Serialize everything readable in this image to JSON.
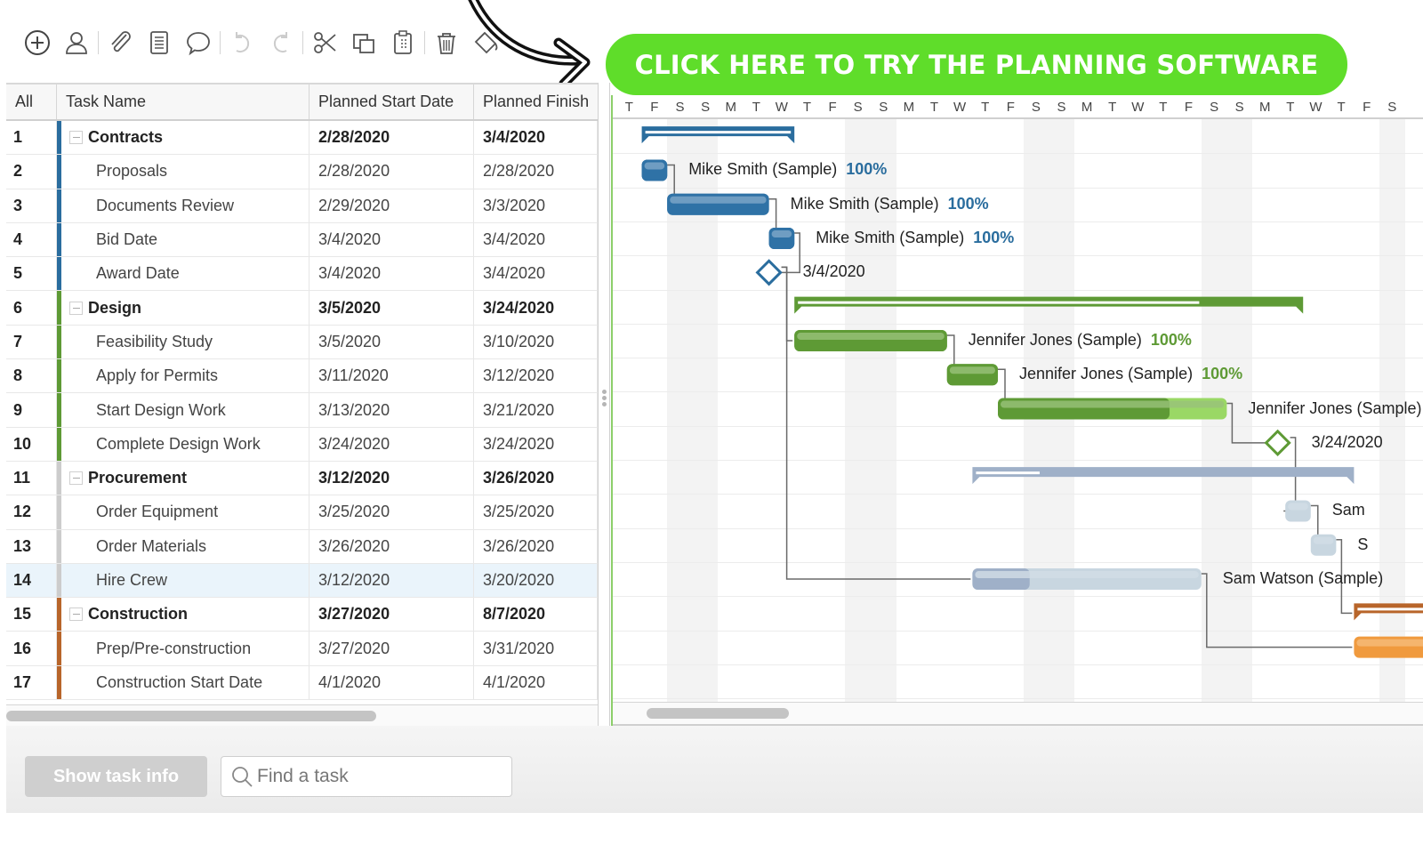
{
  "toolbar": {
    "groups": [
      [
        {
          "icon": "add-circle-icon",
          "label": "Add task"
        },
        {
          "icon": "user-icon",
          "label": "Assign user"
        }
      ],
      [
        {
          "icon": "paperclip-icon",
          "label": "Attach"
        },
        {
          "icon": "document-icon",
          "label": "Notes"
        },
        {
          "icon": "comment-icon",
          "label": "Comment"
        }
      ],
      [
        {
          "icon": "undo-icon",
          "label": "Undo"
        },
        {
          "icon": "redo-icon",
          "label": "Redo"
        }
      ],
      [
        {
          "icon": "scissors-icon",
          "label": "Cut"
        },
        {
          "icon": "copy-icon",
          "label": "Copy"
        },
        {
          "icon": "clipboard-icon",
          "label": "Paste"
        }
      ],
      [
        {
          "icon": "trash-icon",
          "label": "Delete"
        },
        {
          "icon": "paint-bucket-icon",
          "label": "Fill color"
        }
      ]
    ]
  },
  "cta": {
    "label": "CLICK HERE TO TRY THE PLANNING SOFTWARE",
    "color": "#5fdd2a"
  },
  "grid": {
    "columns": {
      "num": "All",
      "name": "Task Name",
      "start": "Planned Start Date",
      "finish": "Planned Finish"
    },
    "rows": [
      {
        "num": "1",
        "name": "Contracts",
        "start": "2/28/2020",
        "finish": "3/4/2020",
        "group": true,
        "color": "#2a6d9e"
      },
      {
        "num": "2",
        "name": "Proposals",
        "start": "2/28/2020",
        "finish": "2/28/2020",
        "group": false,
        "color": "#2a6d9e"
      },
      {
        "num": "3",
        "name": "Documents Review",
        "start": "2/29/2020",
        "finish": "3/3/2020",
        "group": false,
        "color": "#2a6d9e"
      },
      {
        "num": "4",
        "name": "Bid Date",
        "start": "3/4/2020",
        "finish": "3/4/2020",
        "group": false,
        "color": "#2a6d9e"
      },
      {
        "num": "5",
        "name": "Award Date",
        "start": "3/4/2020",
        "finish": "3/4/2020",
        "group": false,
        "color": "#2a6d9e"
      },
      {
        "num": "6",
        "name": "Design",
        "start": "3/5/2020",
        "finish": "3/24/2020",
        "group": true,
        "color": "#5e9a35"
      },
      {
        "num": "7",
        "name": "Feasibility Study",
        "start": "3/5/2020",
        "finish": "3/10/2020",
        "group": false,
        "color": "#5e9a35"
      },
      {
        "num": "8",
        "name": "Apply for Permits",
        "start": "3/11/2020",
        "finish": "3/12/2020",
        "group": false,
        "color": "#5e9a35"
      },
      {
        "num": "9",
        "name": "Start Design Work",
        "start": "3/13/2020",
        "finish": "3/21/2020",
        "group": false,
        "color": "#5e9a35"
      },
      {
        "num": "10",
        "name": "Complete Design Work",
        "start": "3/24/2020",
        "finish": "3/24/2020",
        "group": false,
        "color": "#5e9a35"
      },
      {
        "num": "11",
        "name": "Procurement",
        "start": "3/12/2020",
        "finish": "3/26/2020",
        "group": true,
        "color": "#cccccc"
      },
      {
        "num": "12",
        "name": "Order Equipment",
        "start": "3/25/2020",
        "finish": "3/25/2020",
        "group": false,
        "color": "#cccccc"
      },
      {
        "num": "13",
        "name": "Order Materials",
        "start": "3/26/2020",
        "finish": "3/26/2020",
        "group": false,
        "color": "#cccccc"
      },
      {
        "num": "14",
        "name": "Hire Crew",
        "start": "3/12/2020",
        "finish": "3/20/2020",
        "group": false,
        "color": "#cccccc",
        "selected": true
      },
      {
        "num": "15",
        "name": "Construction",
        "start": "3/27/2020",
        "finish": "8/7/2020",
        "group": true,
        "color": "#b8652a"
      },
      {
        "num": "16",
        "name": "Prep/Pre-construction",
        "start": "3/27/2020",
        "finish": "3/31/2020",
        "group": false,
        "color": "#b8652a"
      },
      {
        "num": "17",
        "name": "Construction Start Date",
        "start": "4/1/2020",
        "finish": "4/1/2020",
        "group": false,
        "color": "#b8652a"
      }
    ]
  },
  "gantt": {
    "days": [
      "T",
      "F",
      "S",
      "S",
      "M",
      "T",
      "W",
      "T",
      "F",
      "S",
      "S",
      "M",
      "T",
      "W",
      "T",
      "F",
      "S",
      "S",
      "M",
      "T",
      "W",
      "T",
      "F",
      "S",
      "S",
      "M",
      "T",
      "W",
      "T",
      "F",
      "S"
    ],
    "first_day": "2/27/2020",
    "bars": [
      {
        "row": 0,
        "type": "summary",
        "start": 1,
        "end": 7,
        "progress": 1.0,
        "color": "#2a6d9e"
      },
      {
        "row": 1,
        "type": "task",
        "start": 1,
        "end": 2,
        "progress": 1.0,
        "color": "#2f72a6",
        "light": "#7fa8c9",
        "label": "Mike Smith (Sample)",
        "pct": "100%",
        "pct_color": "#2a6d9e"
      },
      {
        "row": 2,
        "type": "task",
        "start": 2,
        "end": 6,
        "progress": 1.0,
        "color": "#2f72a6",
        "light": "#7fa8c9",
        "label": "Mike Smith (Sample)",
        "pct": "100%",
        "pct_color": "#2a6d9e"
      },
      {
        "row": 3,
        "type": "task",
        "start": 6,
        "end": 7,
        "progress": 1.0,
        "color": "#2f72a6",
        "light": "#7fa8c9",
        "label": "Mike Smith (Sample)",
        "pct": "100%",
        "pct_color": "#2a6d9e"
      },
      {
        "row": 4,
        "type": "milestone",
        "at": 6,
        "color": "#2a6d9e",
        "label": "3/4/2020"
      },
      {
        "row": 5,
        "type": "summary",
        "start": 7,
        "end": 27,
        "progress": 0.8,
        "color": "#5e9a35"
      },
      {
        "row": 6,
        "type": "task",
        "start": 7,
        "end": 13,
        "progress": 1.0,
        "color": "#5e9a35",
        "light": "#99c27a",
        "label": "Jennifer Jones (Sample)",
        "pct": "100%",
        "pct_color": "#5e9a35"
      },
      {
        "row": 7,
        "type": "task",
        "start": 13,
        "end": 15,
        "progress": 1.0,
        "color": "#5e9a35",
        "light": "#99c27a",
        "label": "Jennifer Jones (Sample)",
        "pct": "100%",
        "pct_color": "#5e9a35"
      },
      {
        "row": 8,
        "type": "task",
        "start": 15,
        "end": 24,
        "progress": 0.75,
        "color": "#5e9a35",
        "light": "#99c27a",
        "remain": "#9ad865",
        "label": "Jennifer Jones (Sample)",
        "pct": "",
        "pct_color": "#5e9a35"
      },
      {
        "row": 9,
        "type": "milestone",
        "at": 26,
        "color": "#5e9a35",
        "label": "3/24/2020"
      },
      {
        "row": 10,
        "type": "summary",
        "start": 14,
        "end": 29,
        "progress": 0.17,
        "color": "#9fb0c8"
      },
      {
        "row": 11,
        "type": "task",
        "start": 26.3,
        "end": 27.3,
        "progress": 0.0,
        "color": "#9fb0c8",
        "light": "#d2dde6",
        "remain": "#c8d6e0",
        "label": "Sam",
        "pct": ""
      },
      {
        "row": 12,
        "type": "task",
        "start": 27.3,
        "end": 28.3,
        "progress": 0.0,
        "color": "#9fb0c8",
        "light": "#d2dde6",
        "remain": "#c8d6e0",
        "label": "S",
        "pct": ""
      },
      {
        "row": 13,
        "type": "task",
        "start": 14,
        "end": 23,
        "progress": 0.25,
        "color": "#9fb0c8",
        "light": "#d2dde6",
        "remain": "#c8d6e0",
        "label": "Sam Watson (Sample)",
        "pct": ""
      },
      {
        "row": 14,
        "type": "summary",
        "start": 29,
        "end": 40,
        "progress": 1.0,
        "color": "#b8652a"
      },
      {
        "row": 15,
        "type": "task",
        "start": 29,
        "end": 34,
        "progress": 0.0,
        "color": "#f09a3e",
        "light": "#f6bb7a",
        "remain": "#f09a3e",
        "label": "",
        "pct": ""
      }
    ]
  },
  "footer": {
    "show_info_label": "Show task info",
    "find_placeholder": "Find a task"
  }
}
